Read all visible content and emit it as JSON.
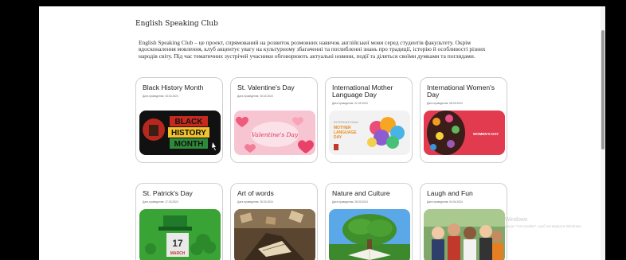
{
  "header": {
    "title": "English Speaking Club"
  },
  "intro": {
    "text": "English Speaking Club – це проект, спрямований на розвиток розмовних навичок англійської мови серед студентів факультету. Окрім вдосконалення мовлення, клуб акцентує увагу на культурному збагаченні та поглибленні знань про традиції, історію й особливості різних народів світу. Під час тематичних зустрічей учасники обговорюють актуальні новини, події та діляться своїми думками та поглядами."
  },
  "events": [
    {
      "title": "Black History Month",
      "date": "Дата проведення: 15.02.2024",
      "image": "black-history-month"
    },
    {
      "title": "St. Valentine's Day",
      "date": "Дата проведення: 15.02.2024",
      "image": "valentines-day"
    },
    {
      "title": "International Mother Language Day",
      "date": "Дата проведення: 21.02.2024",
      "image": "mother-language-day"
    },
    {
      "title": "International Women's Day",
      "date": "Дата проведення: 08.03.2024",
      "image": "womens-day"
    },
    {
      "title": "St. Patrick's Day",
      "date": "Дата проведення: 17.03.2024",
      "image": "st-patricks-day"
    },
    {
      "title": "Art of words",
      "date": "Дата проведення: 25.03.2024",
      "image": "art-of-words"
    },
    {
      "title": "Nature and Culture",
      "date": "Дата проведення: 28.03.2024",
      "image": "nature-and-culture"
    },
    {
      "title": "Laugh and Fun",
      "date": "Дата проведення: 04.04.2024",
      "image": "laugh-and-fun"
    }
  ],
  "image_text": {
    "black_history": [
      "BLACK",
      "HISTORY",
      "MONTH"
    ],
    "valentines": "Valentine's Day",
    "mother_language": [
      "INTERNATIONAL",
      "MOTHER",
      "LANGUAGE",
      "DAY"
    ],
    "womens_day": "WOMEN'S DAY",
    "st_patricks": [
      "17",
      "MARCH"
    ]
  },
  "watermark": {
    "line1": "Windows",
    "line2": "рацію \"Настройки\", щоб активувати Windows."
  },
  "colors": {
    "page_bg": "#ffffff",
    "card_border": "#cfcfcf",
    "text": "#222222"
  }
}
